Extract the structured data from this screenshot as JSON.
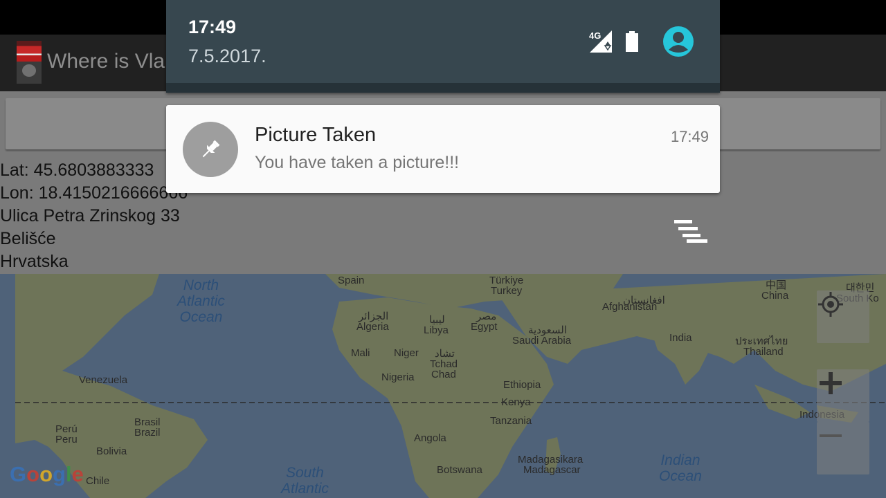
{
  "app": {
    "title": "Where is Vla",
    "take_picture_button_label": "",
    "location": {
      "lat": "Lat: 45.6803883333",
      "lon": "Lon: 18.4150216666666",
      "street": "Ulica Petra Zrinskog 33",
      "city": "Belišće",
      "country": "Hrvatska"
    }
  },
  "map": {
    "labels": {
      "spain": "Spain",
      "turkiye": "Türkiye",
      "turkey": "Turkey",
      "afghanistan_local": "افغانستان",
      "afghanistan": "Afghanistan",
      "china_local": "中国",
      "china": "China",
      "korea_local": "대한민",
      "south_korea": "South Ko",
      "algeria_local": "الجزائر",
      "algeria": "Algeria",
      "libya_local": "ليبيا",
      "libya": "Libya",
      "egypt_local": "مصر",
      "egypt": "Egypt",
      "saudi_local": "السعودية",
      "saudi": "Saudi Arabia",
      "india": "India",
      "thailand_local": "ประเทศไทย",
      "thailand": "Thailand",
      "mali": "Mali",
      "niger": "Niger",
      "chad_local": "تشاد",
      "tchad": "Tchad",
      "chad": "Chad",
      "nigeria": "Nigeria",
      "ethiopia": "Ethiopia",
      "venezuela": "Venezuela",
      "kenya": "Kenya",
      "tanzania": "Tanzania",
      "brasil": "Brasil",
      "brazil": "Brazil",
      "peru_local": "Perú",
      "peru": "Peru",
      "angola": "Angola",
      "indonesia": "Indonesia",
      "bolivia": "Bolivia",
      "madagasikara": "Madagasikara",
      "madagascar": "Madagascar",
      "botswana": "Botswana",
      "chile": "Chile"
    },
    "oceans": {
      "north_atlantic": [
        "North",
        "Atlantic",
        "Ocean"
      ],
      "indian": [
        "Indian",
        "Ocean"
      ],
      "south_atlantic": [
        "South",
        "Atlantic"
      ]
    },
    "logo": "Google",
    "colors": {
      "water": "#4f6279",
      "land": "#6e7458"
    }
  },
  "shade": {
    "time": "17:49",
    "date": "7.5.2017.",
    "network": "4G",
    "header_color": "#37474f",
    "accent": "#26c6da"
  },
  "notification": {
    "title": "Picture Taken",
    "text": "You have taken a picture!!!",
    "time": "17:49",
    "icon": "pin-icon"
  }
}
